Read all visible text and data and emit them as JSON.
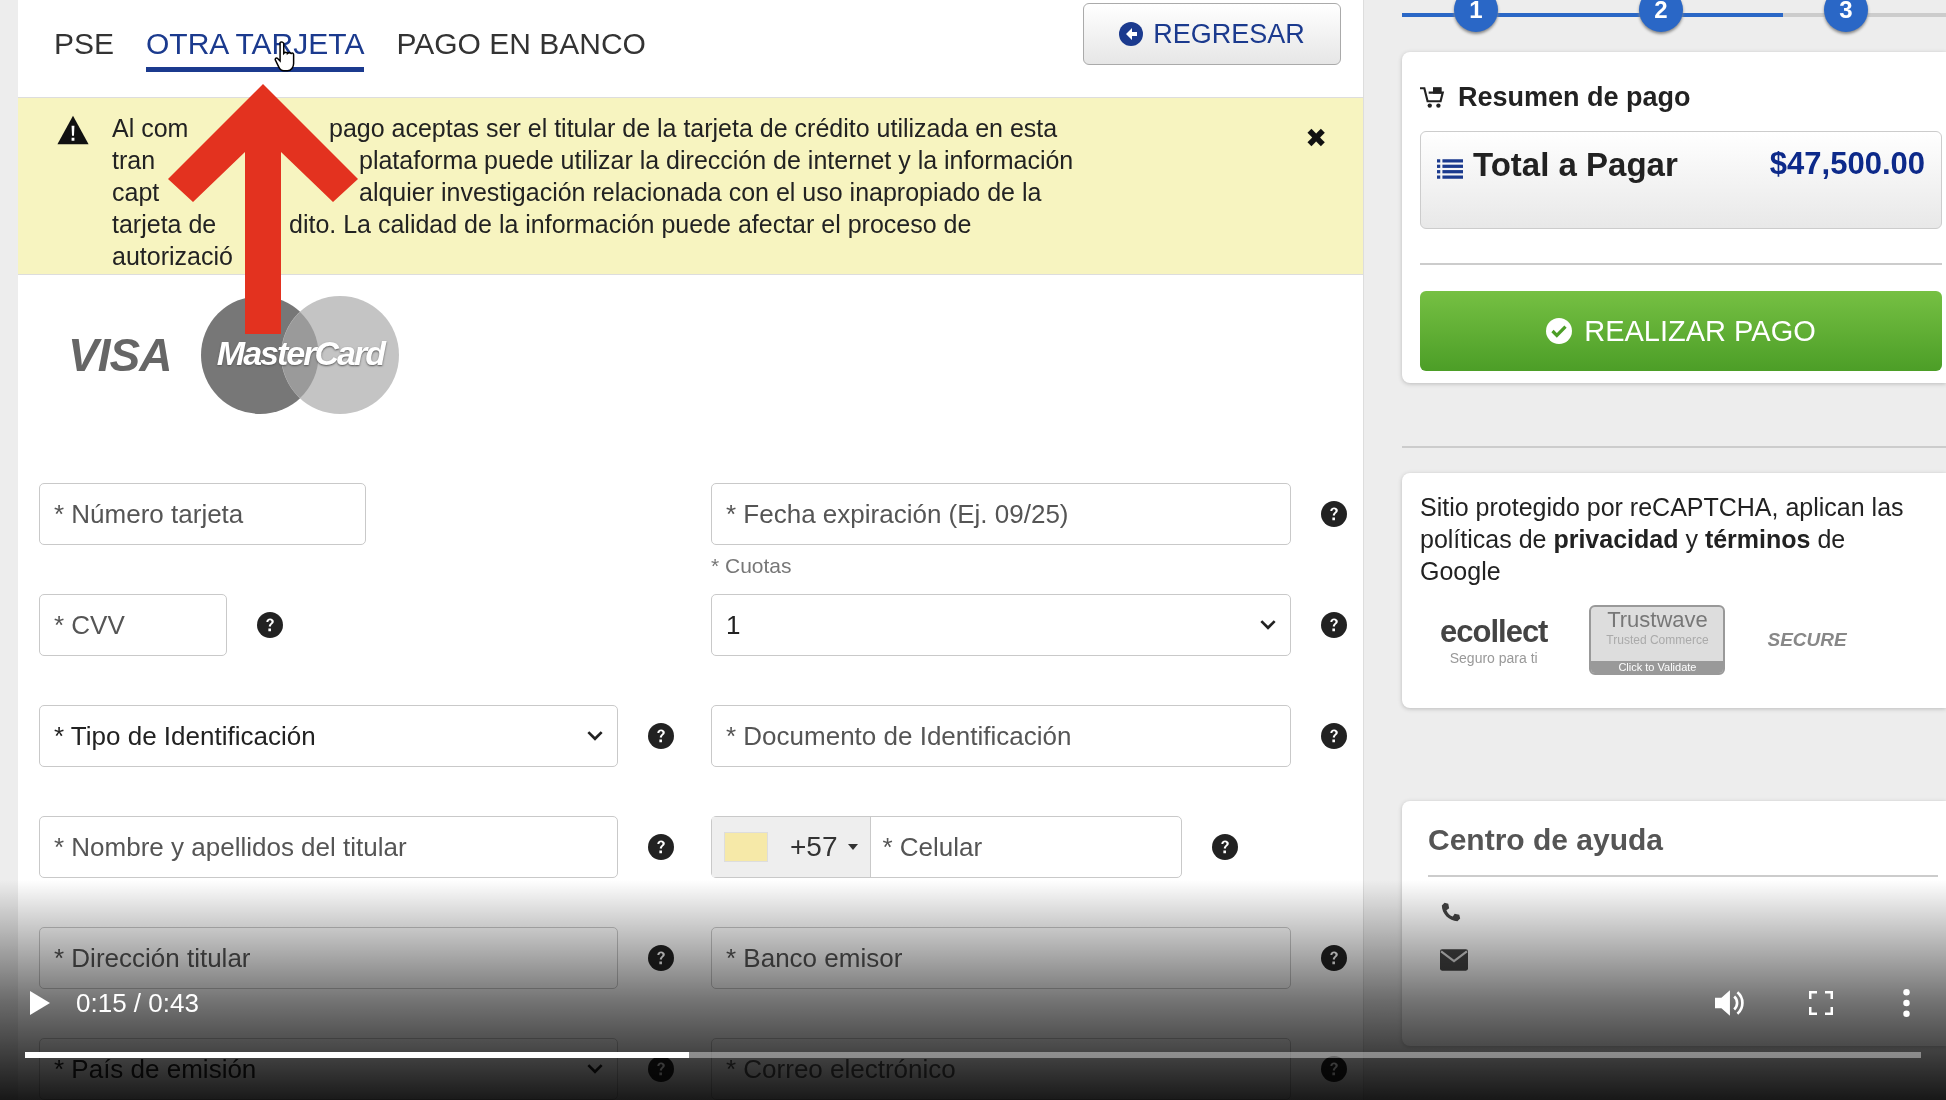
{
  "tabs": [
    {
      "label": "PSE",
      "selected": false
    },
    {
      "label": "OTRA TARJETA",
      "selected": true
    },
    {
      "label": "PAGO EN BANCO",
      "selected": false
    }
  ],
  "back_button": {
    "label": "REGRESAR"
  },
  "notice": {
    "lines": [
      {
        "before": "Al com",
        "after": "pago aceptas ser el titular de la tarjeta de crédito utilizada en esta"
      },
      {
        "before": "tran",
        "after": "plataforma puede utilizar la dirección de internet y la información"
      },
      {
        "before": "capt",
        "after": "alquier investigación relacionada con el uso inapropiado de la"
      },
      {
        "before": "tarjeta de",
        "after": "dito. La calidad de la información puede afectar el proceso de"
      },
      {
        "before": "autorizació"
      }
    ],
    "close": "✖"
  },
  "card_brands": [
    "VISA",
    "MasterCard"
  ],
  "fields": [
    {
      "kind": "input",
      "placeholder": "* Número tarjeta",
      "help": false
    },
    {
      "kind": "input",
      "placeholder": "* Fecha expiración (Ej. 09/25)",
      "help": true
    },
    {
      "kind": "input",
      "placeholder": "* CVV",
      "help": true
    },
    {
      "kind": "select",
      "label": "* Cuotas",
      "value": "1",
      "help": true
    },
    {
      "kind": "select",
      "value": "* Tipo de Identificación",
      "help": true
    },
    {
      "kind": "input",
      "placeholder": "* Documento de Identificación",
      "help": true
    },
    {
      "kind": "input",
      "placeholder": "* Nombre y apellidos del titular",
      "help": true
    },
    {
      "kind": "phone",
      "code": "+57",
      "placeholder": "* Celular",
      "help": true
    },
    {
      "kind": "input",
      "placeholder": "* Dirección titular",
      "help": true
    },
    {
      "kind": "input",
      "placeholder": "* Banco emisor",
      "help": true
    },
    {
      "kind": "select",
      "value": "* País de emisión",
      "help": true
    },
    {
      "kind": "input",
      "placeholder": "* Correo electrónico",
      "help": true
    }
  ],
  "steps": {
    "items": [
      "1",
      "2",
      "3"
    ],
    "level": 0.68
  },
  "summary": {
    "title": "Resumen de pago",
    "total_label": "Total a Pagar",
    "total": "$47,500.00",
    "pay_button": "REALIZAR PAGO"
  },
  "security": {
    "text": "Sitio protegido por reCAPTCHA, aplican las políticas de **privacidad** y **términos** de Google",
    "ecollect": "ecollect",
    "ecollect_tag": "Seguro para ti",
    "trustwave": "Trustwave",
    "trustwave_sub": "Trusted Commerce",
    "trustwave_cta": "Click to Validate",
    "secure": "SECURE"
  },
  "help_center": {
    "title": "Centro de ayuda"
  },
  "video": {
    "time": "0:15 / 0:43",
    "level": 0.35
  }
}
